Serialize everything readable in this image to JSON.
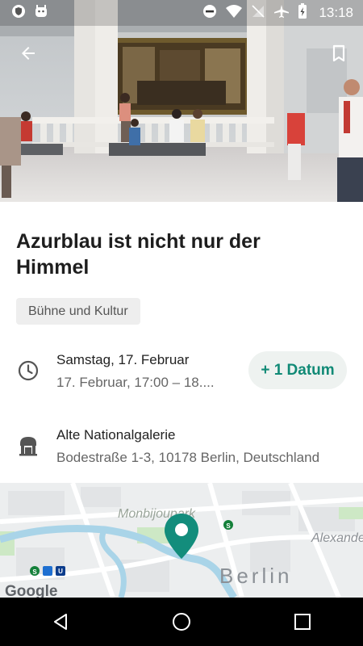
{
  "status_bar": {
    "time": "13:18",
    "icons": [
      "vpn-shield-icon",
      "android-icon",
      "do-not-disturb-icon",
      "wifi-icon",
      "no-signal-icon",
      "airplane-icon",
      "battery-charging-icon"
    ]
  },
  "appbar": {
    "back_icon": "arrow-back-icon",
    "bookmark_icon": "bookmark-icon"
  },
  "event": {
    "title": "Azurblau ist nicht nur der Himmel",
    "category": "Bühne und Kultur",
    "date_primary": "Samstag, 17. Februar",
    "date_secondary": "17. Februar, 17:00 – 18....",
    "more_dates_label": "+ 1 Datum",
    "venue_name": "Alte Nationalgalerie",
    "venue_address": "Bodestraße 1-3, 10178 Berlin, Deutschland"
  },
  "map": {
    "labels": {
      "park": "Monbijoupark",
      "city": "Berlin",
      "district": "Alexande",
      "google": "Google"
    },
    "pin_color": "#138d7c",
    "transit_badges": [
      "S",
      "S",
      "U"
    ]
  },
  "colors": {
    "accent": "#118a76",
    "chip_bg": "#eeeeee",
    "date_button_bg": "#eef2f0"
  },
  "navbar": {
    "icons": [
      "back-triangle-icon",
      "home-circle-icon",
      "recents-square-icon"
    ]
  }
}
